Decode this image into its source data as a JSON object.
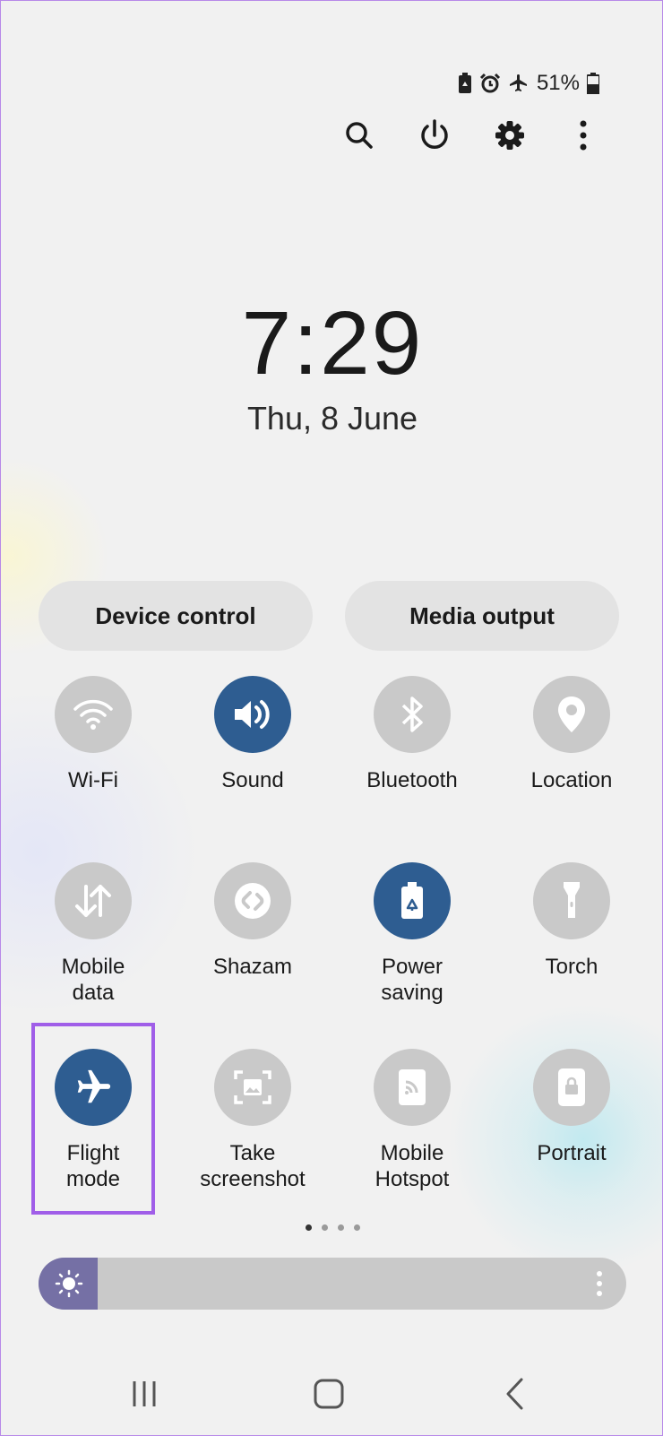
{
  "status_bar": {
    "battery_percent": "51%",
    "icons": [
      "power-saving-icon",
      "alarm-icon",
      "airplane-icon",
      "battery-icon"
    ]
  },
  "top_actions": [
    "search-icon",
    "power-icon",
    "settings-icon",
    "more-options-icon"
  ],
  "clock": {
    "time": "7:29",
    "date": "Thu, 8 June"
  },
  "panel_buttons": {
    "device_control": "Device control",
    "media_output": "Media output"
  },
  "tiles": [
    {
      "label": "Wi-Fi",
      "icon": "wifi-icon",
      "active": false
    },
    {
      "label": "Sound",
      "icon": "sound-icon",
      "active": true
    },
    {
      "label": "Bluetooth",
      "icon": "bluetooth-icon",
      "active": false
    },
    {
      "label": "Location",
      "icon": "location-icon",
      "active": false
    },
    {
      "label": "Mobile\ndata",
      "icon": "mobile-data-icon",
      "active": false
    },
    {
      "label": "Shazam",
      "icon": "shazam-icon",
      "active": false
    },
    {
      "label": "Power\nsaving",
      "icon": "power-saving-icon",
      "active": true
    },
    {
      "label": "Torch",
      "icon": "torch-icon",
      "active": false
    },
    {
      "label": "Flight\nmode",
      "icon": "airplane-icon",
      "active": true,
      "highlighted": true
    },
    {
      "label": "Take\nscreenshot",
      "icon": "screenshot-icon",
      "active": false
    },
    {
      "label": "Mobile\nHotspot",
      "icon": "hotspot-icon",
      "active": false
    },
    {
      "label": "Portrait",
      "icon": "portrait-lock-icon",
      "active": false
    }
  ],
  "page_indicator": {
    "pages": 4,
    "current": 1
  },
  "brightness": {
    "level": 0.1,
    "icon": "sun-icon"
  },
  "nav_bar": [
    "recent-apps-icon",
    "home-icon",
    "back-icon"
  ],
  "colors": {
    "active_tile": "#2e5d91",
    "inactive_tile": "#c9c9c9",
    "highlight": "#a05ee8",
    "brightness_fill": "#7570a5"
  }
}
